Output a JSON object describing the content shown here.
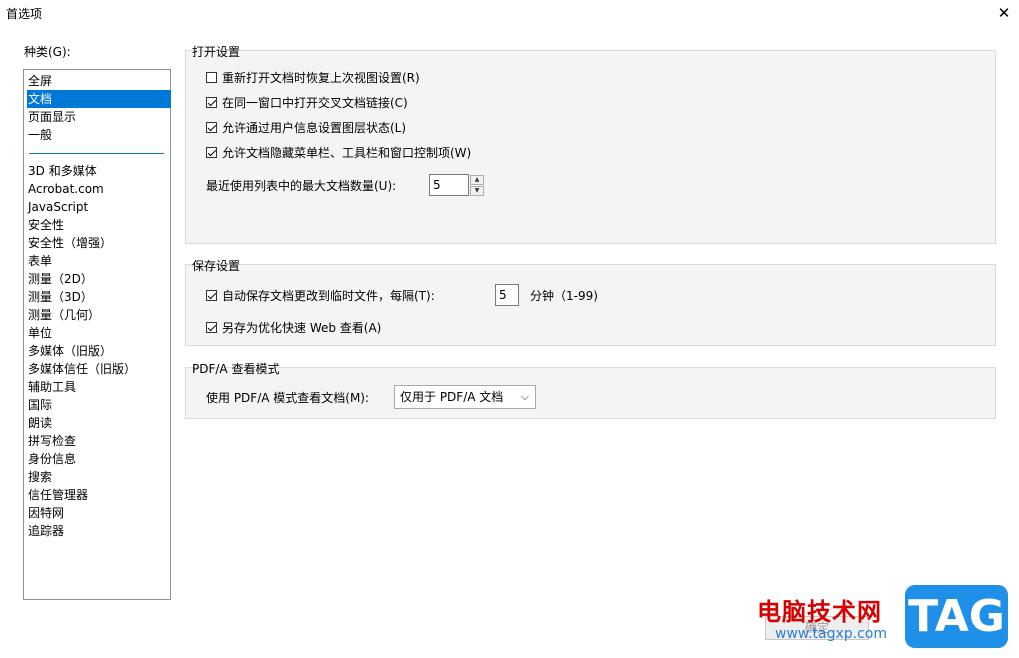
{
  "window": {
    "title": "首选项",
    "close_glyph": "✕"
  },
  "categories": {
    "label": "种类(G):",
    "top_items": [
      "全屏",
      "文档",
      "页面显示",
      "一般"
    ],
    "selected": "文档",
    "items": [
      "3D 和多媒体",
      "Acrobat.com",
      "JavaScript",
      "安全性",
      "安全性（增强）",
      "表单",
      "测量（2D）",
      "测量（3D）",
      "测量（几何）",
      "单位",
      "多媒体（旧版）",
      "多媒体信任（旧版）",
      "辅助工具",
      "国际",
      "朗读",
      "拼写检查",
      "身份信息",
      "搜索",
      "信任管理器",
      "因特网",
      "追踪器"
    ]
  },
  "open_settings": {
    "title": "打开设置",
    "options": [
      {
        "label": "重新打开文档时恢复上次视图设置(R)",
        "checked": false
      },
      {
        "label": "在同一窗口中打开交叉文档链接(C)",
        "checked": true
      },
      {
        "label": "允许通过用户信息设置图层状态(L)",
        "checked": true
      },
      {
        "label": "允许文档隐藏菜单栏、工具栏和窗口控制项(W)",
        "checked": true
      }
    ],
    "max_docs_label": "最近使用列表中的最大文档数量(U):",
    "max_docs_value": "5"
  },
  "save_settings": {
    "title": "保存设置",
    "autosave_label": "自动保存文档更改到临时文件，每隔(T):",
    "autosave_checked": true,
    "autosave_value": "5",
    "autosave_unit": "分钟（1-99)",
    "fastweb_label": "另存为优化快速 Web 查看(A)",
    "fastweb_checked": true
  },
  "pdfa": {
    "title": "PDF/A 查看模式",
    "label": "使用 PDF/A 模式查看文档(M):",
    "selected_option": "仅用于 PDF/A 文档"
  },
  "buttons": {
    "ok_label": "确定"
  },
  "watermark": {
    "site_name": "电脑技术网",
    "url": "www.tagxp.com",
    "tag": "TAG"
  }
}
